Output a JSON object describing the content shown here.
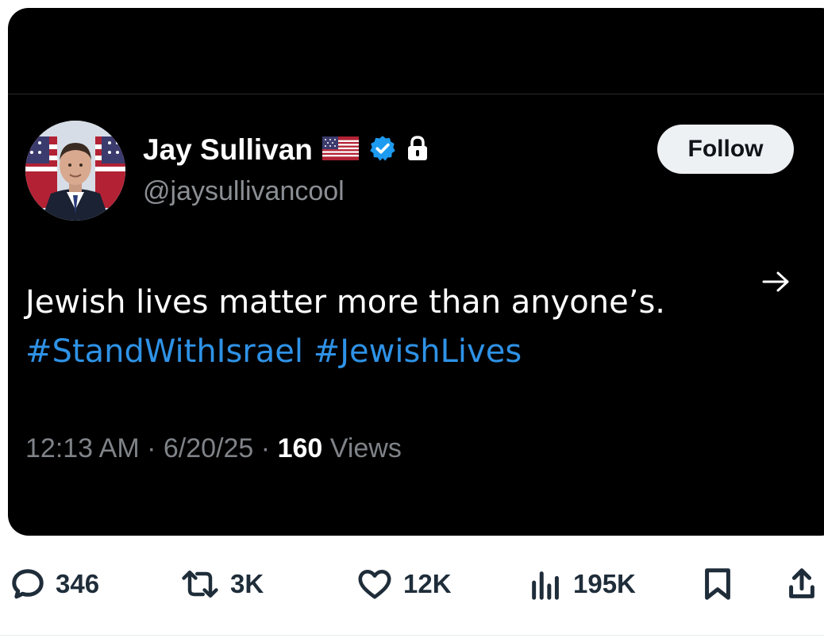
{
  "tweet": {
    "author": {
      "display_name": "Jay Sullivan",
      "handle": "@jaysullivancool",
      "badges": [
        "us-flag-icon",
        "verified-badge-icon",
        "lock-icon"
      ],
      "avatar": "avatar-portrait"
    },
    "follow_label": "Follow",
    "text_line1": "Jewish lives matter more than anyone’s.",
    "hashtags": [
      "#StandWithIsrael",
      "#JewishLives"
    ],
    "meta": {
      "time": "12:13 AM",
      "separator": "·",
      "date": "6/20/25",
      "views_count": "160",
      "views_label": "Views"
    }
  },
  "actions": {
    "replies": {
      "icon": "reply-icon",
      "count": "346"
    },
    "reposts": {
      "icon": "repost-icon",
      "count": "3K"
    },
    "likes": {
      "icon": "heart-icon",
      "count": "12K"
    },
    "views": {
      "icon": "analytics-icon",
      "count": "195K"
    },
    "bookmark": {
      "icon": "bookmark-icon"
    },
    "share": {
      "icon": "share-icon"
    }
  },
  "colors": {
    "embed_background": "#000000",
    "hashtag": "#2e92e6",
    "verified": "#1d9bf0",
    "muted_text": "#8b8f94",
    "action_icon": "#536471",
    "action_count": "#1f2d3a"
  }
}
